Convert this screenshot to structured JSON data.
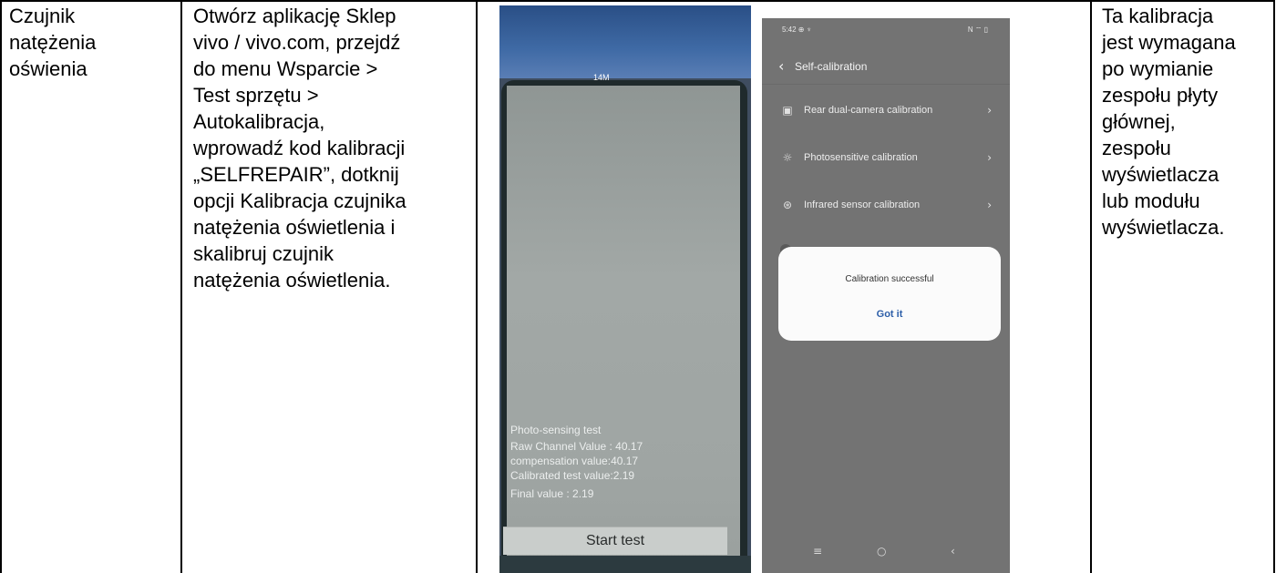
{
  "col1": {
    "text": "Czujnik\nnatężenia\noświenia"
  },
  "col2": {
    "text": "Otwórz aplikację Sklep\nvivo / vivo.com, przejdź\ndo menu Wsparcie >\nTest sprzętu >\nAutokalibracja,\nwprowadź kod kalibracji\n„SELFREPAIR”, dotknij\nopcji Kalibracja czujnika\nnatężenia oświetlenia i\nskalibruj czujnik\nnatężenia oświetlenia."
  },
  "col4": {
    "text": "Ta kalibracja\njest wymagana\npo wymianie\nzespołu płyty\ngłównej,\nzespołu\nwyświetlacza\nlub modułu\nwyświetlacza."
  },
  "photo1": {
    "tape_label": "14M",
    "test_title": "Photo-sensing test",
    "raw_channel": "Raw Channel Value : 40.17",
    "compensation": "compensation value:40.17",
    "calibrated": "Calibrated test value:2.19",
    "final": "Final value : 2.19",
    "start_button": "Start test"
  },
  "photo2": {
    "status_time": "5:42 ⊕ ♆",
    "status_icons": "N ⌔ ▯",
    "back_icon": "‹",
    "title": "Self-calibration",
    "rows": [
      {
        "icon": "▣",
        "label": "Rear dual-camera calibration",
        "chevron": "›"
      },
      {
        "icon": "☼",
        "label": "Photosensitive calibration",
        "chevron": "›"
      },
      {
        "icon": "⊛",
        "label": "Infrared sensor calibration",
        "chevron": "›"
      }
    ],
    "dialog_message": "Calibration successful",
    "dialog_button": "Got it",
    "nav_menu": "≡",
    "nav_home": "○",
    "nav_back": "‹"
  }
}
